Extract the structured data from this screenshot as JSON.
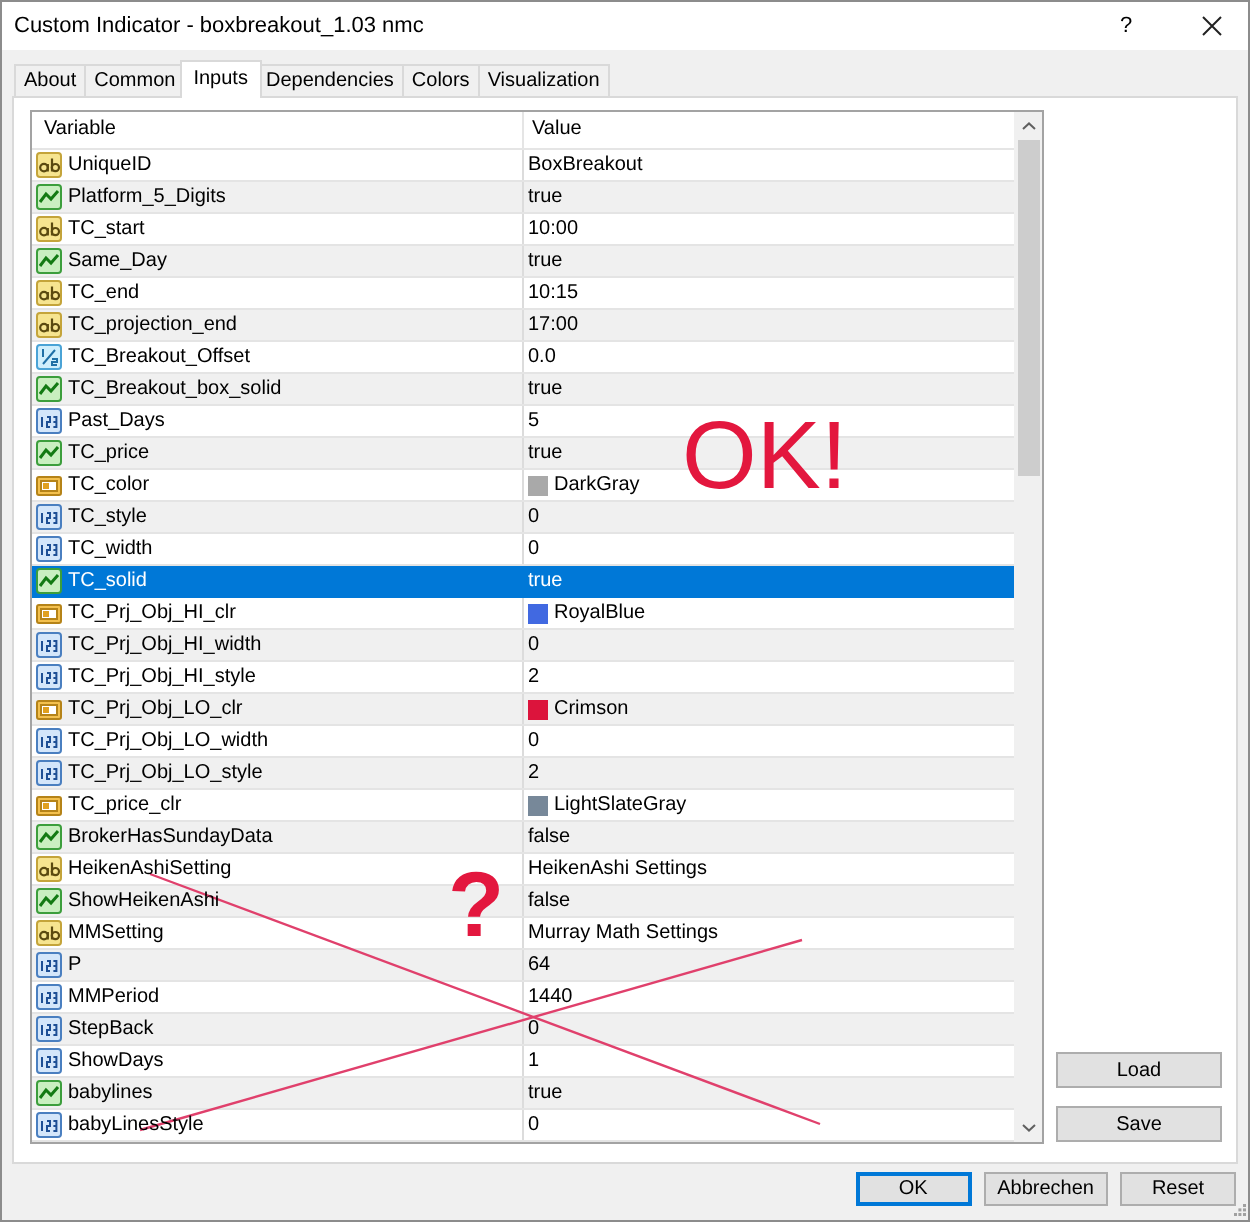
{
  "window": {
    "title": "Custom Indicator - boxbreakout_1.03 nmc",
    "help_button": "?"
  },
  "tabs": [
    {
      "label": "About",
      "selected": false
    },
    {
      "label": "Common",
      "selected": false
    },
    {
      "label": "Inputs",
      "selected": true
    },
    {
      "label": "Dependencies",
      "selected": false
    },
    {
      "label": "Colors",
      "selected": false
    },
    {
      "label": "Visualization",
      "selected": false
    }
  ],
  "table": {
    "columns": [
      "Variable",
      "Value"
    ],
    "rows": [
      {
        "kind": "string",
        "variable": "UniqueID",
        "value": "BoxBreakout",
        "selected": false
      },
      {
        "kind": "bool",
        "variable": "Platform_5_Digits",
        "value": "true",
        "selected": false
      },
      {
        "kind": "string",
        "variable": "TC_start",
        "value": "10:00",
        "selected": false
      },
      {
        "kind": "bool",
        "variable": "Same_Day",
        "value": "true",
        "selected": false
      },
      {
        "kind": "string",
        "variable": "TC_end",
        "value": "10:15",
        "selected": false
      },
      {
        "kind": "string",
        "variable": "TC_projection_end",
        "value": "17:00",
        "selected": false
      },
      {
        "kind": "double",
        "variable": "TC_Breakout_Offset",
        "value": "0.0",
        "selected": false
      },
      {
        "kind": "bool",
        "variable": "TC_Breakout_box_solid",
        "value": "true",
        "selected": false
      },
      {
        "kind": "int",
        "variable": "Past_Days",
        "value": "5",
        "selected": false
      },
      {
        "kind": "bool",
        "variable": "TC_price",
        "value": "true",
        "selected": false
      },
      {
        "kind": "color",
        "variable": "TC_color",
        "value": "DarkGray",
        "color": "#a9a9a9",
        "selected": false
      },
      {
        "kind": "int",
        "variable": "TC_style",
        "value": "0",
        "selected": false
      },
      {
        "kind": "int",
        "variable": "TC_width",
        "value": "0",
        "selected": false
      },
      {
        "kind": "bool",
        "variable": "TC_solid",
        "value": "true",
        "selected": true
      },
      {
        "kind": "color",
        "variable": "TC_Prj_Obj_HI_clr",
        "value": "RoyalBlue",
        "color": "#4169e1",
        "selected": false
      },
      {
        "kind": "int",
        "variable": "TC_Prj_Obj_HI_width",
        "value": "0",
        "selected": false
      },
      {
        "kind": "int",
        "variable": "TC_Prj_Obj_HI_style",
        "value": "2",
        "selected": false
      },
      {
        "kind": "color",
        "variable": "TC_Prj_Obj_LO_clr",
        "value": "Crimson",
        "color": "#dc143c",
        "selected": false
      },
      {
        "kind": "int",
        "variable": "TC_Prj_Obj_LO_width",
        "value": "0",
        "selected": false
      },
      {
        "kind": "int",
        "variable": "TC_Prj_Obj_LO_style",
        "value": "2",
        "selected": false
      },
      {
        "kind": "color",
        "variable": "TC_price_clr",
        "value": "LightSlateGray",
        "color": "#778899",
        "selected": false
      },
      {
        "kind": "bool",
        "variable": "BrokerHasSundayData",
        "value": "false",
        "selected": false
      },
      {
        "kind": "string",
        "variable": "HeikenAshiSetting",
        "value": "HeikenAshi Settings",
        "selected": false
      },
      {
        "kind": "bool",
        "variable": "ShowHeikenAshi",
        "value": "false",
        "selected": false
      },
      {
        "kind": "string",
        "variable": "MMSetting",
        "value": "Murray Math Settings",
        "selected": false
      },
      {
        "kind": "int",
        "variable": "P",
        "value": "64",
        "selected": false
      },
      {
        "kind": "int",
        "variable": "MMPeriod",
        "value": "1440",
        "selected": false
      },
      {
        "kind": "int",
        "variable": "StepBack",
        "value": "0",
        "selected": false
      },
      {
        "kind": "int",
        "variable": "ShowDays",
        "value": "1",
        "selected": false
      },
      {
        "kind": "bool",
        "variable": "babylines",
        "value": "true",
        "selected": false
      },
      {
        "kind": "int",
        "variable": "babyLinesStyle",
        "value": "0",
        "selected": false
      }
    ]
  },
  "side_buttons": [
    "Load",
    "Save"
  ],
  "footer_buttons": [
    {
      "label": "OK",
      "default": true
    },
    {
      "label": "Abbrechen",
      "default": false
    },
    {
      "label": "Reset",
      "default": false
    }
  ],
  "annotations": [
    {
      "kind": "text",
      "text": "OK!"
    },
    {
      "kind": "text",
      "text": "?"
    },
    {
      "kind": "cross"
    }
  ]
}
